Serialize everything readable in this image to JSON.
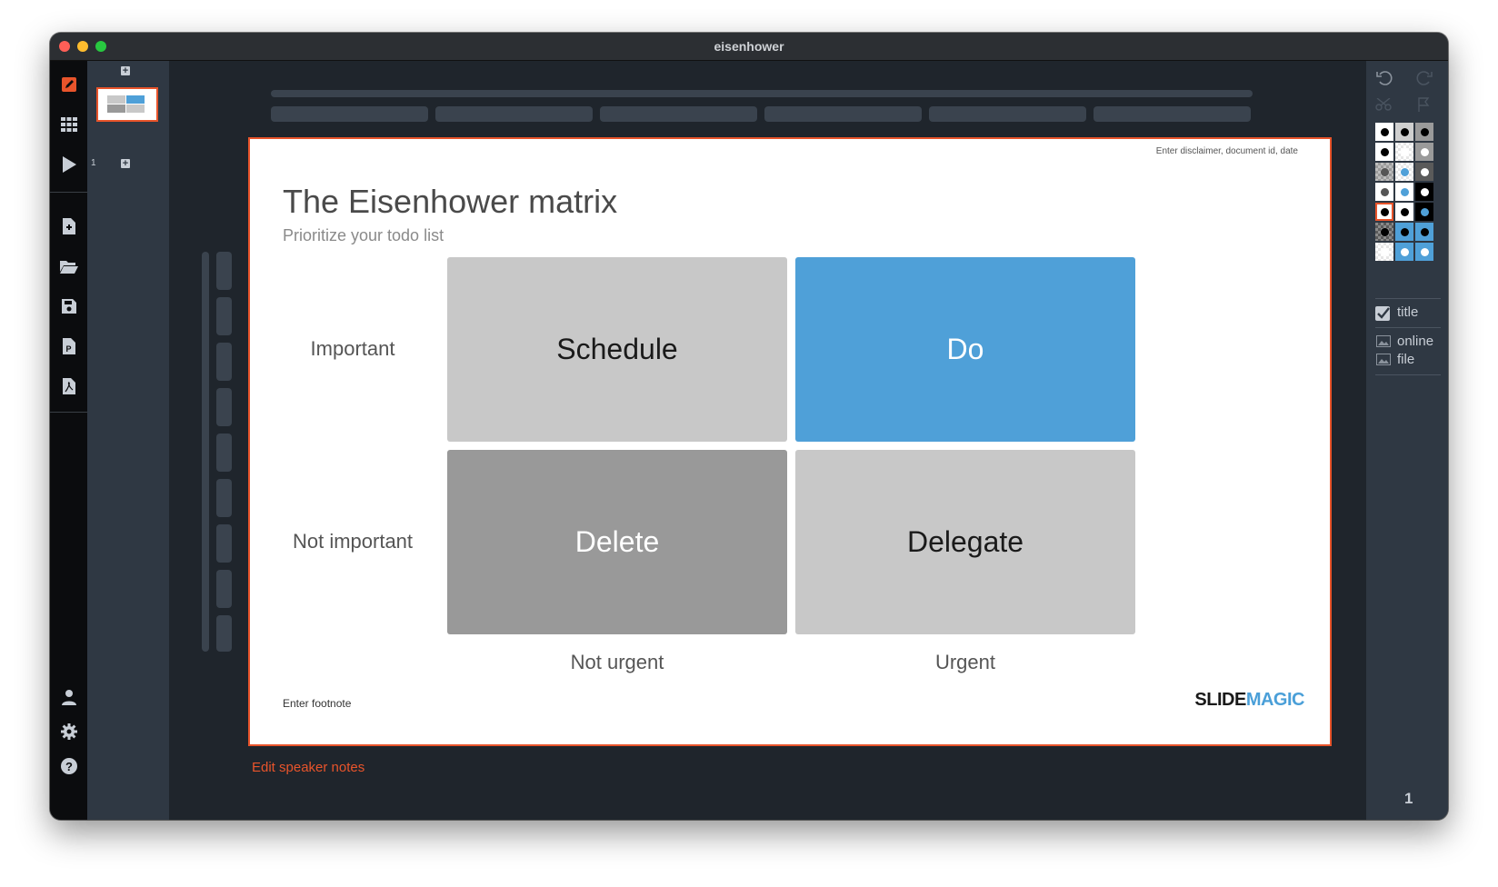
{
  "window": {
    "title": "eisenhower"
  },
  "left_toolbar": {
    "icons": [
      "edit-icon",
      "grid-icon",
      "play-icon",
      "new-file-icon",
      "open-folder-icon",
      "save-icon",
      "export-pptx-icon",
      "export-pdf-icon",
      "account-icon",
      "settings-icon",
      "help-icon"
    ]
  },
  "thumbnails": {
    "slide_numbers": [
      "1"
    ],
    "add_label": "+"
  },
  "slide": {
    "disclaimer": "Enter disclaimer, document id, date",
    "title": "The Eisenhower matrix",
    "subtitle": "Prioritize your todo list",
    "rows": [
      "Important",
      "Not important"
    ],
    "columns": [
      "Not urgent",
      "Urgent"
    ],
    "cells": [
      {
        "label": "Schedule",
        "bg": "#c8c8c8",
        "fg": "#1a1a1a"
      },
      {
        "label": "Do",
        "bg": "#4fa0d8",
        "fg": "#ffffff"
      },
      {
        "label": "Delete",
        "bg": "#999999",
        "fg": "#ffffff"
      },
      {
        "label": "Delegate",
        "bg": "#c8c8c8",
        "fg": "#1a1a1a"
      }
    ],
    "footnote": "Enter footnote",
    "logo": {
      "part1": "SLIDE",
      "part2": "MAGIC"
    }
  },
  "speaker_notes_link": "Edit speaker notes",
  "right_panel": {
    "toggle_title": {
      "label": "title",
      "checked": true
    },
    "image_online": "online",
    "image_file": "file",
    "page_number": "1"
  },
  "colors": {
    "accent": "#e8542b",
    "blue": "#4fa0d8",
    "panel": "#2f3843",
    "canvas": "#1f252c"
  }
}
